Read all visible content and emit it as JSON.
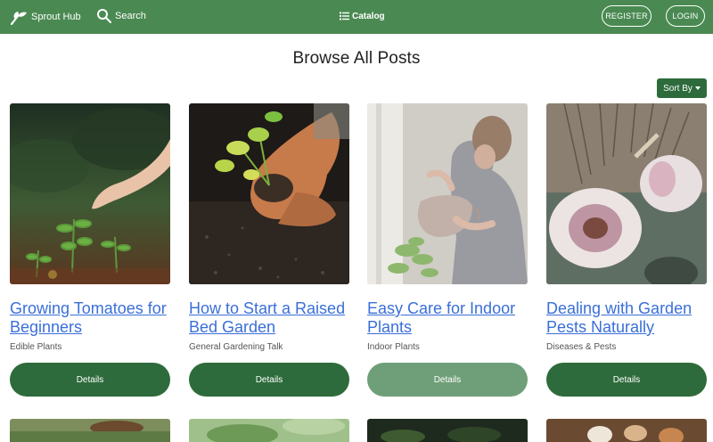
{
  "nav": {
    "brand": "Sprout Hub",
    "search": "Search",
    "catalog": "Catalog",
    "register": "REGISTER",
    "login": "LOGIN"
  },
  "page": {
    "title": "Browse All Posts",
    "sort_label": "Sort By"
  },
  "posts": [
    {
      "title": "Growing Tomatoes for Beginners",
      "category": "Edible Plants",
      "button": "Details"
    },
    {
      "title": "How to Start a Raised Bed Garden",
      "category": "General Gardening Talk",
      "button": "Details"
    },
    {
      "title": "Easy Care for Indoor Plants",
      "category": "Indoor Plants",
      "button": "Details"
    },
    {
      "title": "Dealing with Garden Pests Naturally",
      "category": "Diseases & Pests",
      "button": "Details"
    }
  ],
  "colors": {
    "navbar": "#4a8a52",
    "button": "#2e6b3c",
    "button_hover": "#6f9f78",
    "link": "#3a6fd8"
  }
}
